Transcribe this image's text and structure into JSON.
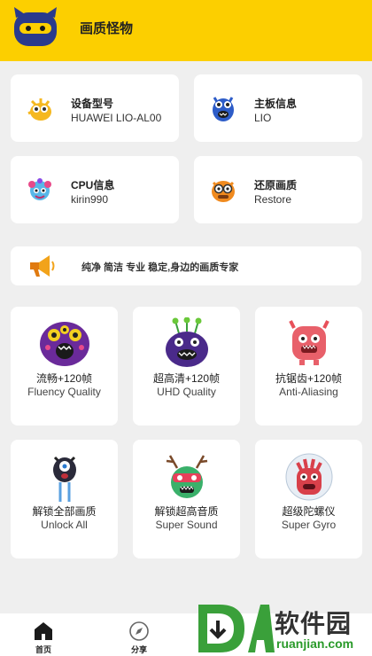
{
  "header": {
    "title": "画质怪物",
    "bg": "#fccf00"
  },
  "info_cards": [
    {
      "title": "设备型号",
      "value": "HUAWEI LIO-AL00",
      "icon": "chick-monster-icon"
    },
    {
      "title": "主板信息",
      "value": "LIO",
      "icon": "blue-monster-icon"
    },
    {
      "title": "CPU信息",
      "value": "kirin990",
      "icon": "fluffy-monster-icon"
    },
    {
      "title": "还原画质",
      "value": "Restore",
      "icon": "orange-monster-icon"
    }
  ],
  "banner": {
    "text": "纯净 简洁 专业 稳定,身边的画质专家",
    "icon": "megaphone-icon"
  },
  "features": [
    {
      "title": "流畅+120帧",
      "subtitle": "Fluency Quality",
      "icon": "purple-monster-icon"
    },
    {
      "title": "超高清+120帧",
      "subtitle": "UHD Quality",
      "icon": "antenna-monster-icon"
    },
    {
      "title": "抗锯齿+120帧",
      "subtitle": "Anti-Aliasing",
      "icon": "pink-monster-icon"
    },
    {
      "title": "解锁全部画质",
      "subtitle": "Unlock All",
      "icon": "one-eye-monster-icon"
    },
    {
      "title": "解锁超高音质",
      "subtitle": "Super Sound",
      "icon": "antler-monster-icon"
    },
    {
      "title": "超级陀螺仪",
      "subtitle": "Super Gyro",
      "icon": "red-monster-icon"
    }
  ],
  "tabbar": [
    {
      "label": "首页",
      "icon": "home-icon"
    },
    {
      "label": "分享",
      "icon": "compass-icon"
    }
  ],
  "watermark": {
    "cn": "软件园",
    "url": "ruanjian.com"
  }
}
